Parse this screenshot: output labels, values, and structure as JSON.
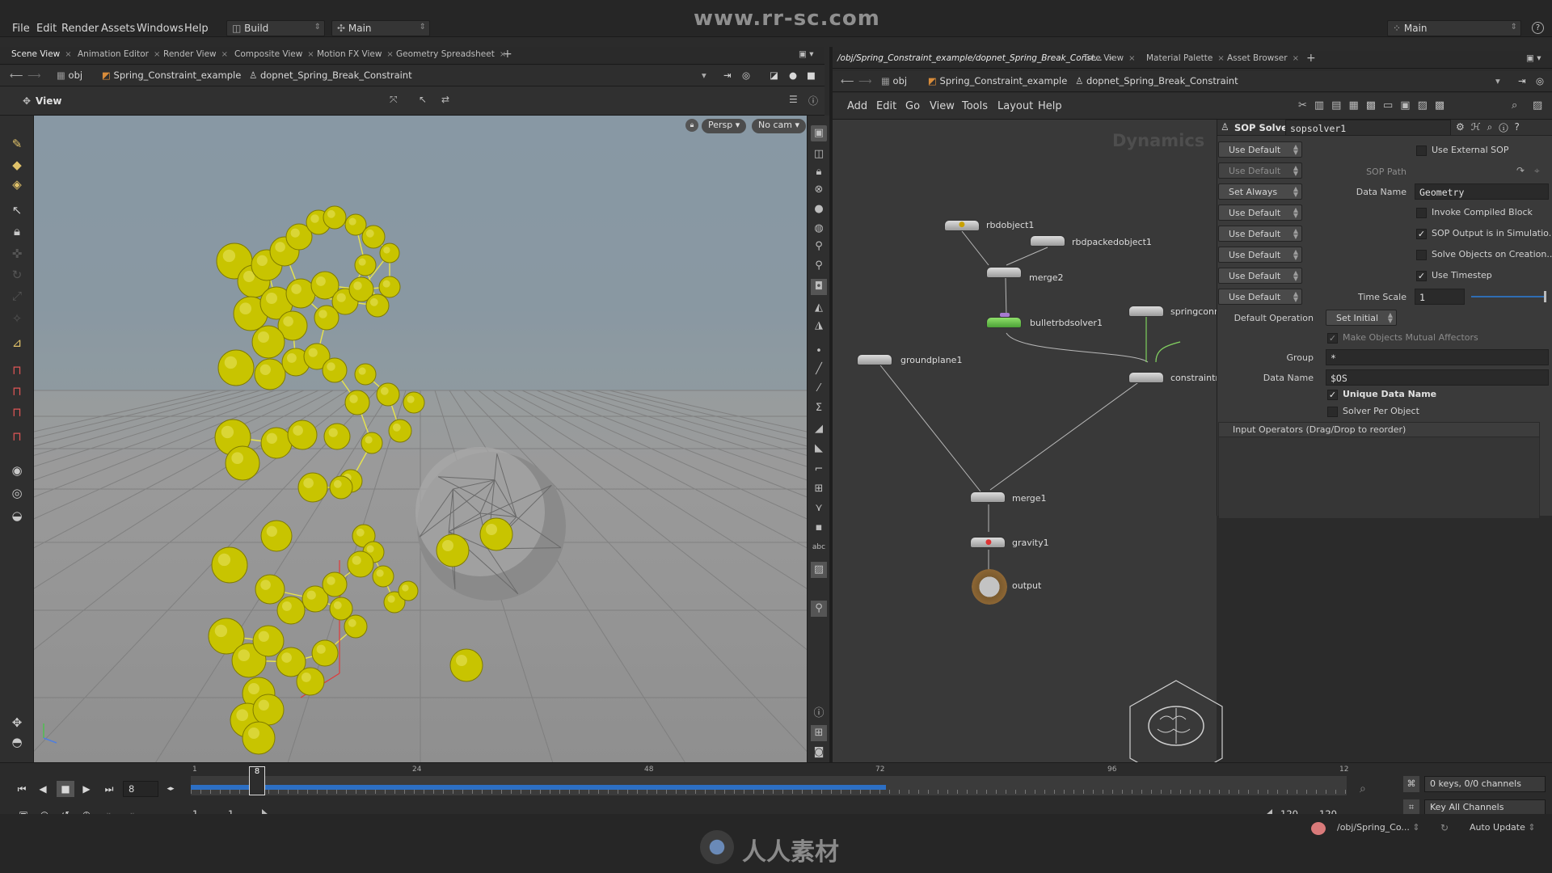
{
  "watermark": {
    "url": "www.rr-sc.com",
    "footer": "人人素材"
  },
  "menubar": {
    "items": [
      "File",
      "Edit",
      "Render",
      "Assets",
      "Windows",
      "Help"
    ],
    "build_label": "Build",
    "desktop_label": "Main",
    "right_desktop_label": "Main"
  },
  "left_tabs": [
    "Scene View",
    "Animation Editor",
    "Render View",
    "Composite View",
    "Motion FX View",
    "Geometry Spreadsheet"
  ],
  "left_path": {
    "root": "obj",
    "crumbs": [
      "Spring_Constraint_example",
      "dopnet_Spring_Break_Constraint"
    ]
  },
  "viewport": {
    "title": "View",
    "persp_label": "Persp",
    "cam_label": "No cam"
  },
  "right_tabs": [
    "/obj/Spring_Constraint_example/dopnet_Spring_Break_Const...",
    "Tree View",
    "Material Palette",
    "Asset Browser"
  ],
  "right_path": {
    "root": "obj",
    "crumbs": [
      "Spring_Constraint_example",
      "dopnet_Spring_Break_Constraint"
    ]
  },
  "network_menu": [
    "Add",
    "Edit",
    "Go",
    "View",
    "Tools",
    "Layout",
    "Help"
  ],
  "network": {
    "context_label": "Dynamics",
    "nodes": {
      "rbdobject1": "rbdobject1",
      "rbdpackedobject1": "rbdpackedobject1",
      "merge2": "merge2",
      "springconstraint": "springconre",
      "bulletrbdsolver1": "bulletrbdsolver1",
      "groundplane1": "groundplane1",
      "constraint": "constraintn",
      "merge1": "merge1",
      "gravity1": "gravity1",
      "output": "output"
    }
  },
  "params": {
    "node_type": "SOP Solver",
    "node_name": "sopsolver1",
    "left_buttons": [
      "Use Default",
      "Use Default",
      "Set Always",
      "Use Default",
      "Use Default",
      "Use Default",
      "Use Default",
      "Use Default"
    ],
    "use_external_sop": "Use External SOP",
    "sop_path_label": "SOP Path",
    "data_name_label": "Data Name",
    "data_name_value": "Geometry",
    "invoke_compiled": "Invoke Compiled Block",
    "sop_output_sim": "SOP Output is in Simulatio...",
    "solve_objects": "Solve Objects on Creation...",
    "use_timestep": "Use Timestep",
    "time_scale_label": "Time Scale",
    "time_scale_value": "1",
    "default_operation_label": "Default Operation",
    "default_operation_value": "Set Initial",
    "make_mutual": "Make Objects Mutual Affectors",
    "group_label": "Group",
    "group_value": "*",
    "data_name2_label": "Data Name",
    "data_name2_value": "$OS",
    "unique_data_name": "Unique Data Name",
    "solver_per_object": "Solver Per Object",
    "input_operators": "Input Operators (Drag/Drop to reorder)"
  },
  "timeline": {
    "current_frame": "8",
    "current_frame_marker": "8",
    "ticks": [
      "1",
      "24",
      "48",
      "72",
      "96",
      "12"
    ],
    "range_start": "1",
    "range_start2": "1",
    "range_end": "120",
    "range_end2": "120",
    "keys_label": "0 keys, 0/0 channels",
    "key_all_label": "Key All Channels",
    "status_path": "/obj/Spring_Co...",
    "auto_update": "Auto Update"
  },
  "colors": {
    "sphere": "#c8c400",
    "wire": "#e6e24a",
    "timeline_blue": "#2c6fc4",
    "node_green": "#7ccc5a"
  }
}
